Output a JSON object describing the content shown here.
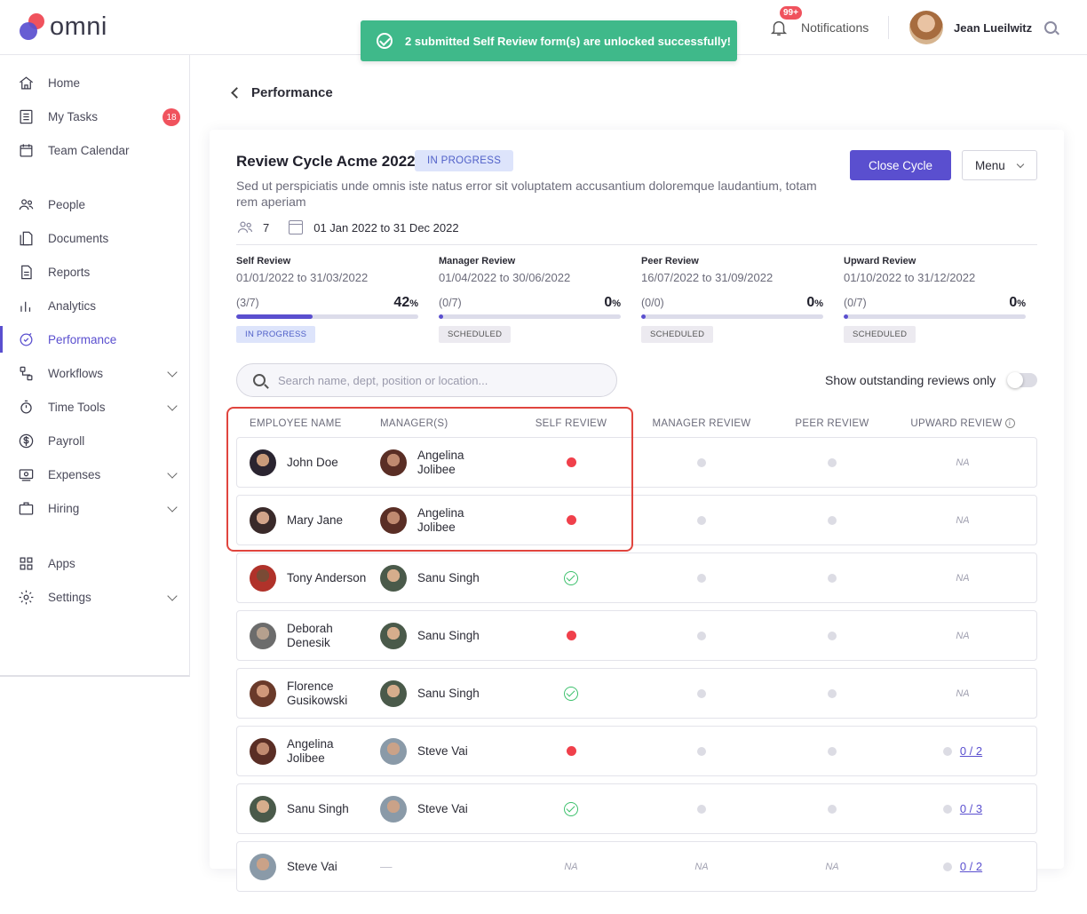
{
  "app": {
    "brand": "omni"
  },
  "toast": {
    "message": "2 submitted Self Review form(s) are unlocked successfully!"
  },
  "header": {
    "notif_badge": "99+",
    "notif_label": "Notifications",
    "user_name": "Jean Lueilwitz"
  },
  "sidebar": {
    "items": [
      {
        "label": "Home",
        "icon": "home-icon"
      },
      {
        "label": "My Tasks",
        "icon": "tasks-icon",
        "badge": "18"
      },
      {
        "label": "Team Calendar",
        "icon": "calendar-icon"
      },
      {
        "label": "People",
        "icon": "people-icon"
      },
      {
        "label": "Documents",
        "icon": "documents-icon"
      },
      {
        "label": "Reports",
        "icon": "reports-icon"
      },
      {
        "label": "Analytics",
        "icon": "analytics-icon"
      },
      {
        "label": "Performance",
        "icon": "performance-icon",
        "active": true
      },
      {
        "label": "Workflows",
        "icon": "workflows-icon",
        "expandable": true
      },
      {
        "label": "Time Tools",
        "icon": "timer-icon",
        "expandable": true
      },
      {
        "label": "Payroll",
        "icon": "dollar-icon"
      },
      {
        "label": "Expenses",
        "icon": "expenses-icon",
        "expandable": true
      },
      {
        "label": "Hiring",
        "icon": "briefcase-icon",
        "expandable": true
      },
      {
        "label": "Apps",
        "icon": "apps-icon"
      },
      {
        "label": "Settings",
        "icon": "settings-icon",
        "expandable": true
      }
    ]
  },
  "page": {
    "back_label": "Performance"
  },
  "cycle": {
    "title": "Review Cycle Acme 2022",
    "status": "IN PROGRESS",
    "close_label": "Close Cycle",
    "menu_label": "Menu",
    "description": "Sed ut perspiciatis unde omnis iste natus error sit voluptatem accusantium doloremque laudantium, totam rem aperiam",
    "participants": "7",
    "date_range": "01 Jan 2022 to 31 Dec 2022"
  },
  "phases": [
    {
      "name": "Self Review",
      "dates": "01/01/2022 to 31/03/2022",
      "count": "(3/7)",
      "pct": "42",
      "progress": 0.42,
      "status": "IN PROGRESS"
    },
    {
      "name": "Manager Review",
      "dates": "01/04/2022 to 30/06/2022",
      "count": "(0/7)",
      "pct": "0",
      "progress": 0,
      "status": "SCHEDULED"
    },
    {
      "name": "Peer Review",
      "dates": "16/07/2022 to 31/09/2022",
      "count": "(0/0)",
      "pct": "0",
      "progress": 0,
      "status": "SCHEDULED"
    },
    {
      "name": "Upward Review",
      "dates": "01/10/2022 to 31/12/2022",
      "count": "(0/7)",
      "pct": "0",
      "progress": 0,
      "status": "SCHEDULED"
    }
  ],
  "search": {
    "placeholder": "Search name, dept, position or location..."
  },
  "filter": {
    "outstanding_label": "Show outstanding reviews only",
    "outstanding_on": false
  },
  "table": {
    "columns": [
      "EMPLOYEE NAME",
      "MANAGER(S)",
      "SELF REVIEW",
      "MANAGER REVIEW",
      "PEER REVIEW",
      "UPWARD REVIEW"
    ],
    "rows": [
      {
        "employee": [
          "John Doe"
        ],
        "manager": [
          "Angelina",
          "Jolibee"
        ],
        "self": "red",
        "mgr": "gray",
        "peer": "gray",
        "upward": "NA"
      },
      {
        "employee": [
          "Mary Jane"
        ],
        "manager": [
          "Angelina",
          "Jolibee"
        ],
        "self": "red",
        "mgr": "gray",
        "peer": "gray",
        "upward": "NA"
      },
      {
        "employee": [
          "Tony Anderson"
        ],
        "manager": [
          "Sanu Singh"
        ],
        "self": "check",
        "mgr": "gray",
        "peer": "gray",
        "upward": "NA"
      },
      {
        "employee": [
          "Deborah",
          "Denesik"
        ],
        "manager": [
          "Sanu Singh"
        ],
        "self": "red",
        "mgr": "gray",
        "peer": "gray",
        "upward": "NA"
      },
      {
        "employee": [
          "Florence",
          "Gusikowski"
        ],
        "manager": [
          "Sanu Singh"
        ],
        "self": "check",
        "mgr": "gray",
        "peer": "gray",
        "upward": "NA"
      },
      {
        "employee": [
          "Angelina",
          "Jolibee"
        ],
        "manager": [
          "Steve Vai"
        ],
        "self": "red",
        "mgr": "gray",
        "peer": "gray",
        "upward": "0 / 2"
      },
      {
        "employee": [
          "Sanu Singh"
        ],
        "manager": [
          "Steve Vai"
        ],
        "self": "check",
        "mgr": "gray",
        "peer": "gray",
        "upward": "0 / 3"
      },
      {
        "employee": [
          "Steve Vai"
        ],
        "manager": [
          "—"
        ],
        "self": "NA",
        "mgr": "NA",
        "peer": "NA",
        "upward": "0 / 2"
      }
    ]
  },
  "colors": {
    "accent": "#5a4fcf",
    "success": "#3fb98a",
    "danger": "#f0404b",
    "highlight": "#e0453e"
  }
}
